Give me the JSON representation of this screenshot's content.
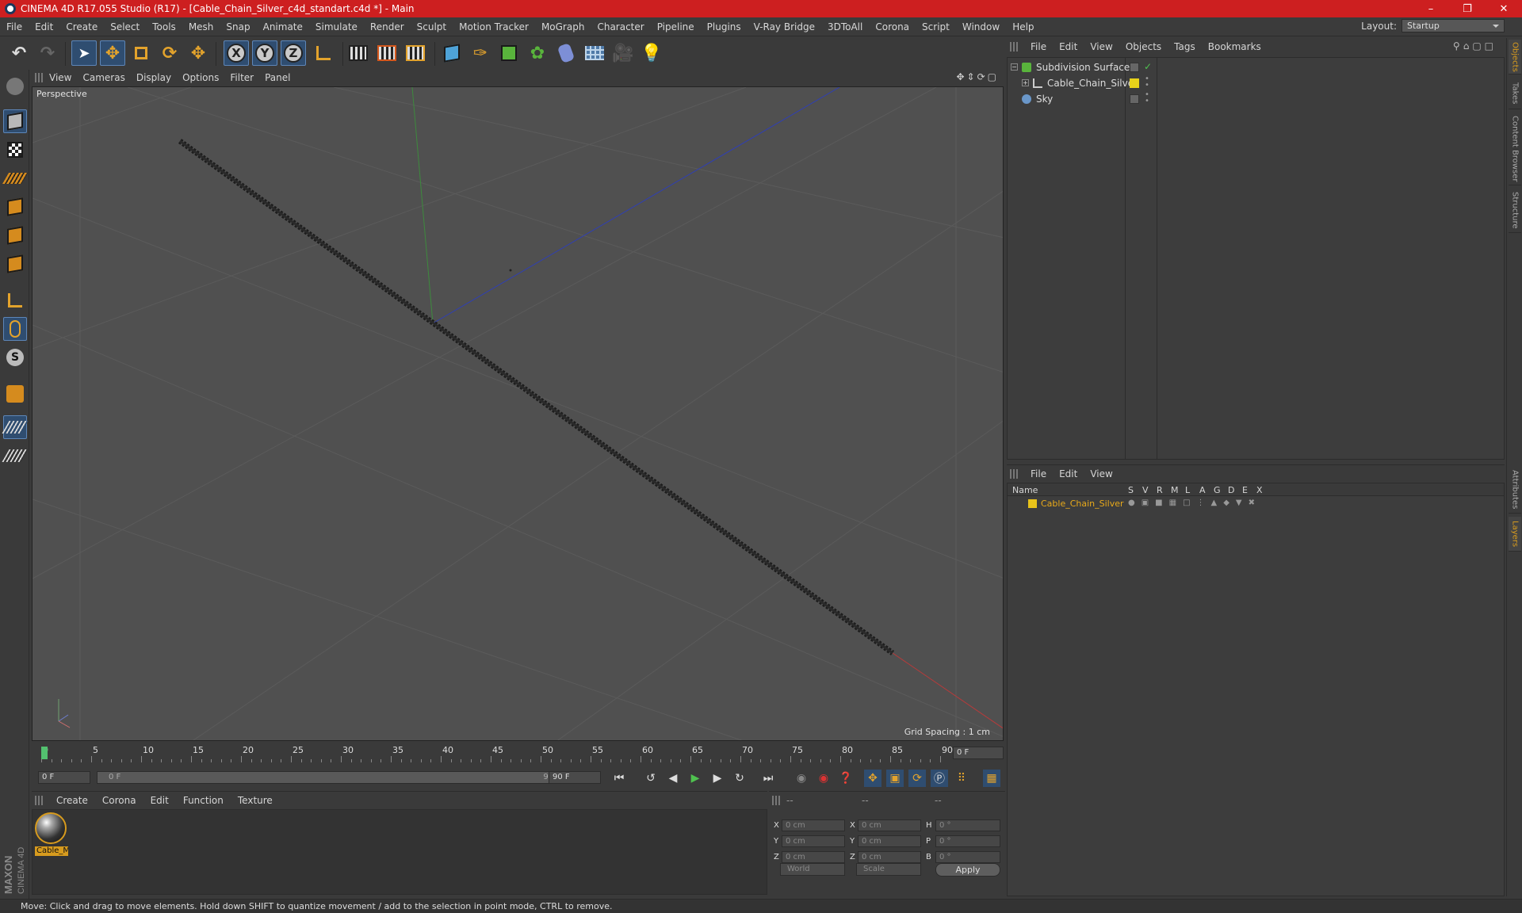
{
  "window": {
    "title": "CINEMA 4D R17.055 Studio (R17) - [Cable_Chain_Silver_c4d_standart.c4d *] - Main"
  },
  "menu": [
    "File",
    "Edit",
    "Create",
    "Select",
    "Tools",
    "Mesh",
    "Snap",
    "Animate",
    "Simulate",
    "Render",
    "Sculpt",
    "Motion Tracker",
    "MoGraph",
    "Character",
    "Pipeline",
    "Plugins",
    "V-Ray Bridge",
    "3DToAll",
    "Corona",
    "Script",
    "Window",
    "Help"
  ],
  "layout": {
    "label": "Layout:",
    "value": "Startup"
  },
  "toolbar": {
    "axis_x": "X",
    "axis_y": "Y",
    "axis_z": "Z"
  },
  "viewport": {
    "menu": [
      "View",
      "Cameras",
      "Display",
      "Options",
      "Filter",
      "Panel"
    ],
    "label": "Perspective",
    "grid_spacing": "Grid Spacing : 1 cm"
  },
  "timeline": {
    "ticks": [
      "0",
      "5",
      "10",
      "15",
      "20",
      "25",
      "30",
      "35",
      "40",
      "45",
      "50",
      "55",
      "60",
      "65",
      "70",
      "75",
      "80",
      "85",
      "90"
    ],
    "current_frame_field": "0 F"
  },
  "transport": {
    "start_field": "0 F",
    "range_start": "0 F",
    "range_end": "90 F",
    "end_field": "90 F"
  },
  "material_manager": {
    "menu": [
      "Create",
      "Corona",
      "Edit",
      "Function",
      "Texture"
    ],
    "materials": [
      {
        "name": "Cable_M"
      }
    ]
  },
  "coordinates": {
    "header": [
      "--",
      "--",
      "--"
    ],
    "rows": [
      {
        "a": "X",
        "v1": "0 cm",
        "b": "X",
        "v2": "0 cm",
        "c": "H",
        "v3": "0 °"
      },
      {
        "a": "Y",
        "v1": "0 cm",
        "b": "Y",
        "v2": "0 cm",
        "c": "P",
        "v3": "0 °"
      },
      {
        "a": "Z",
        "v1": "0 cm",
        "b": "Z",
        "v2": "0 cm",
        "c": "B",
        "v3": "0 °"
      }
    ],
    "mode_world": "World",
    "mode_scale": "Scale",
    "apply": "Apply"
  },
  "object_manager": {
    "menu": [
      "File",
      "Edit",
      "View",
      "Objects",
      "Tags",
      "Bookmarks"
    ],
    "objects": [
      {
        "name": "Subdivision Surface"
      },
      {
        "name": "Cable_Chain_Silver"
      },
      {
        "name": "Sky"
      }
    ]
  },
  "layer_manager": {
    "menu": [
      "File",
      "Edit",
      "View"
    ],
    "columns": [
      "Name",
      "S",
      "V",
      "R",
      "M",
      "L",
      "A",
      "G",
      "D",
      "E",
      "X"
    ],
    "layers": [
      {
        "name": "Cable_Chain_Silver",
        "color": "#e8c31a"
      }
    ]
  },
  "right_tabs": [
    "Objects",
    "Takes",
    "Content Browser",
    "Structure",
    "Attributes",
    "Layers"
  ],
  "status": "Move: Click and drag to move elements. Hold down SHIFT to quantize movement / add to the selection in point mode, CTRL to remove.",
  "maxon_logo": "MAXON CINEMA 4D",
  "colors": {
    "accent": "#d79b1e",
    "titlebar": "#cd1f20",
    "selection": "#2f4d70"
  }
}
